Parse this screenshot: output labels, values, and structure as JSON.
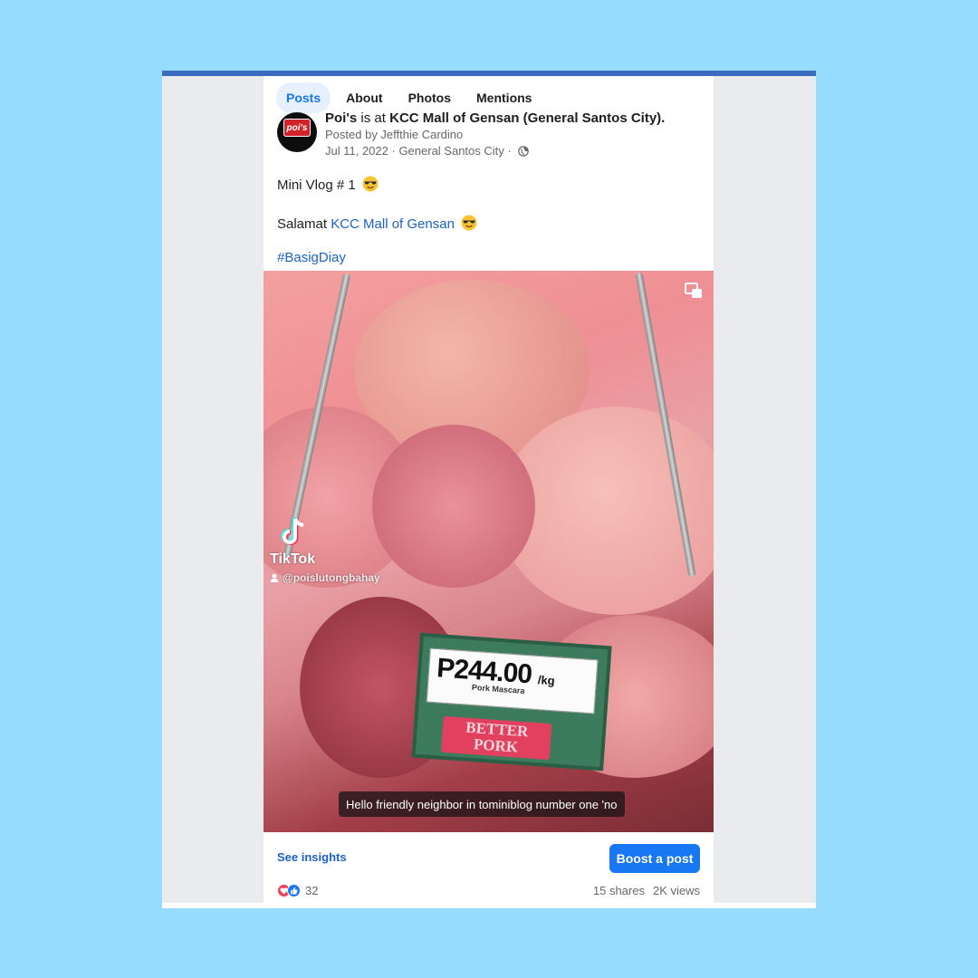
{
  "tabs": [
    {
      "label": "Posts",
      "active": true
    },
    {
      "label": "About",
      "active": false
    },
    {
      "label": "Photos",
      "active": false
    },
    {
      "label": "Mentions",
      "active": false
    }
  ],
  "post": {
    "avatar_text": "poi's",
    "author_name": "Poi's",
    "author_verb": "is at",
    "place": "KCC Mall of Gensan (General Santos City).",
    "posted_by": "Posted by Jeffthie Cardino",
    "date": "Jul 11, 2022",
    "separator": " · ",
    "location": "General Santos City",
    "line1": "Mini Vlog # 1",
    "line2_prefix": "Salamat",
    "line2_link": "KCC Mall of Gensan",
    "hashtag": "#BasigDiay",
    "emoji_name": "smiling-face-with-sunglasses-icon"
  },
  "video": {
    "tiktok_name": "TikTok",
    "tiktok_handle": "@poislutongbahay",
    "price": "P244.00",
    "price_unit": "/kg",
    "price_item": "Pork Mascara",
    "brand_line1": "BETTER",
    "brand_line2": "PORK",
    "caption": "Hello friendly neighbor in tominiblog number one 'no"
  },
  "footer": {
    "insights_label": "See insights",
    "boost_label": "Boost a post",
    "reaction_count": "32",
    "shares": "15 shares",
    "views": "2K views"
  },
  "colors": {
    "accent": "#1877f2",
    "link": "#1b63c6",
    "background": "#95dcff",
    "top_bar": "#3b6bbf"
  }
}
